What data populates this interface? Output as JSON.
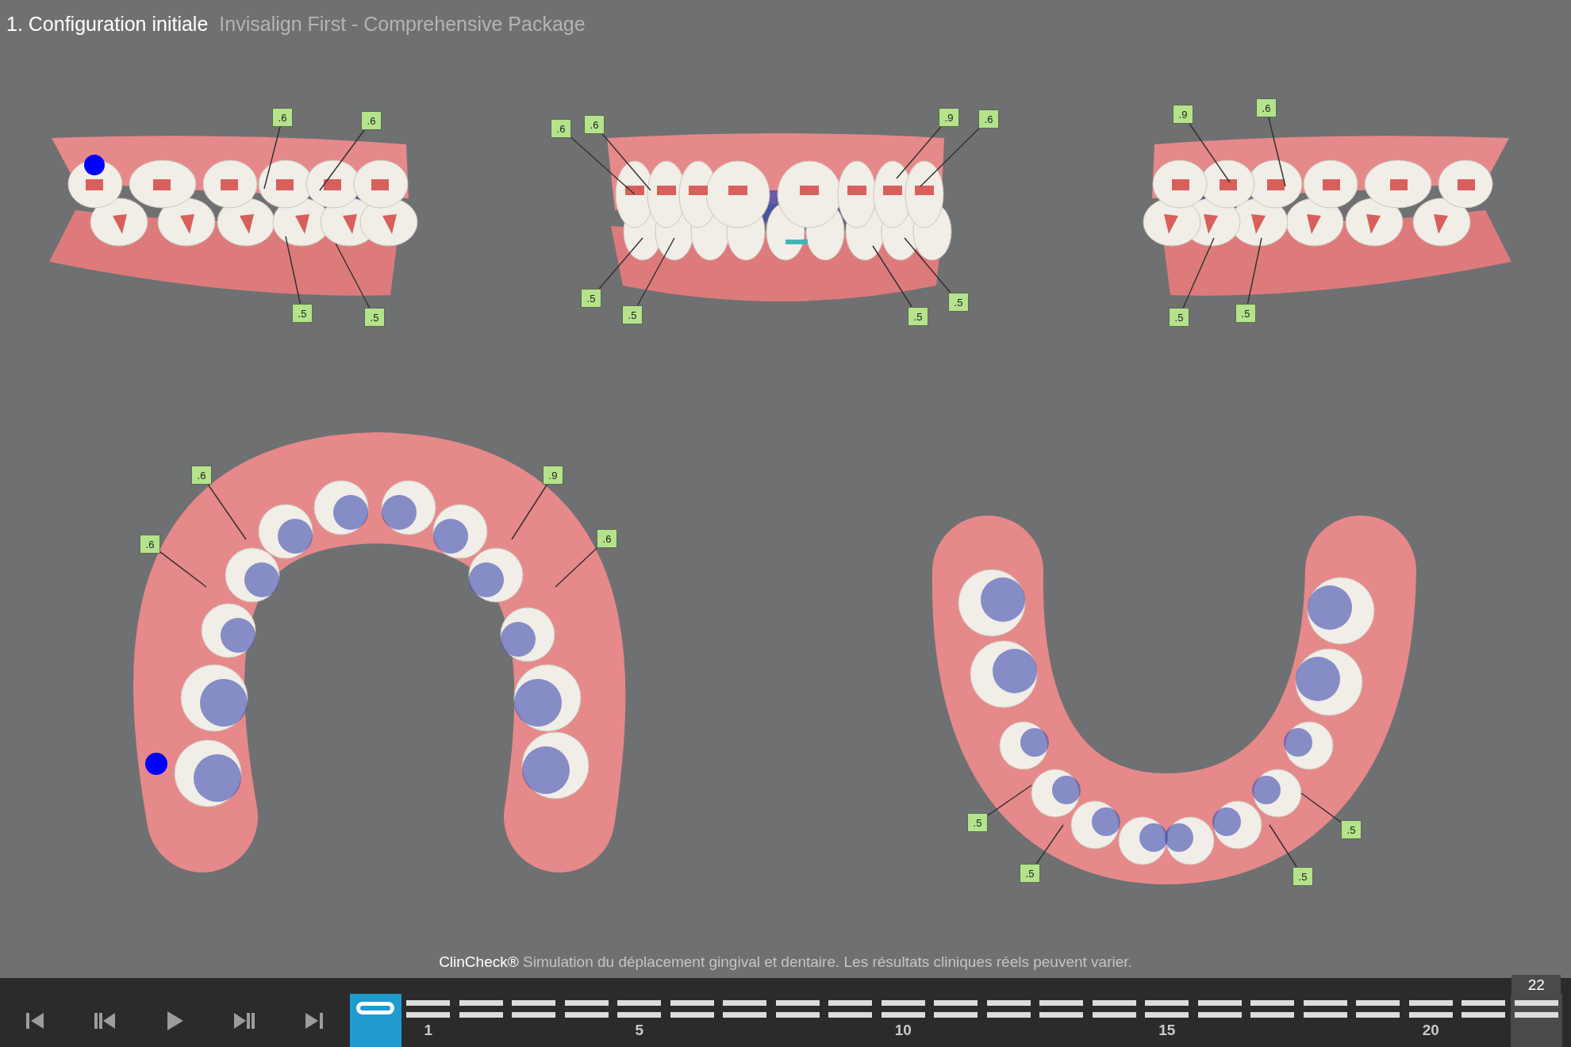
{
  "header": {
    "title": "1. Configuration initiale",
    "subtitle": "Invisalign First - Comprehensive Package"
  },
  "views": [
    {
      "tags": [
        ".6",
        ".6",
        ".5",
        ".5"
      ]
    },
    {
      "tags": [
        ".6",
        ".6",
        ".9",
        ".6",
        ".5",
        ".5",
        ".5",
        ".5"
      ]
    },
    {
      "tags": [
        ".9",
        ".6",
        ".5",
        ".5"
      ]
    },
    {
      "tags": [
        ".6",
        ".9",
        ".6",
        ".6"
      ]
    },
    {
      "tags": [
        ".5",
        ".5",
        ".5",
        ".5"
      ]
    }
  ],
  "caption": {
    "brand": "ClinCheck®",
    "text": "Simulation du déplacement gingival et dentaire. Les résultats cliniques réels peuvent varier."
  },
  "timeline": {
    "total": "22",
    "stages": [
      {
        "selected": true
      },
      {
        "label": "1",
        "selected": false
      },
      {
        "selected": false
      },
      {
        "selected": false
      },
      {
        "selected": false
      },
      {
        "label": "5",
        "selected": false
      },
      {
        "selected": false
      },
      {
        "selected": false
      },
      {
        "selected": false
      },
      {
        "selected": false
      },
      {
        "label": "10",
        "selected": false
      },
      {
        "selected": false
      },
      {
        "selected": false
      },
      {
        "selected": false
      },
      {
        "selected": false
      },
      {
        "label": "15",
        "selected": false
      },
      {
        "selected": false
      },
      {
        "selected": false
      },
      {
        "selected": false
      },
      {
        "selected": false
      },
      {
        "label": "20",
        "selected": false
      },
      {
        "selected": false
      },
      {
        "selected": false
      }
    ]
  }
}
